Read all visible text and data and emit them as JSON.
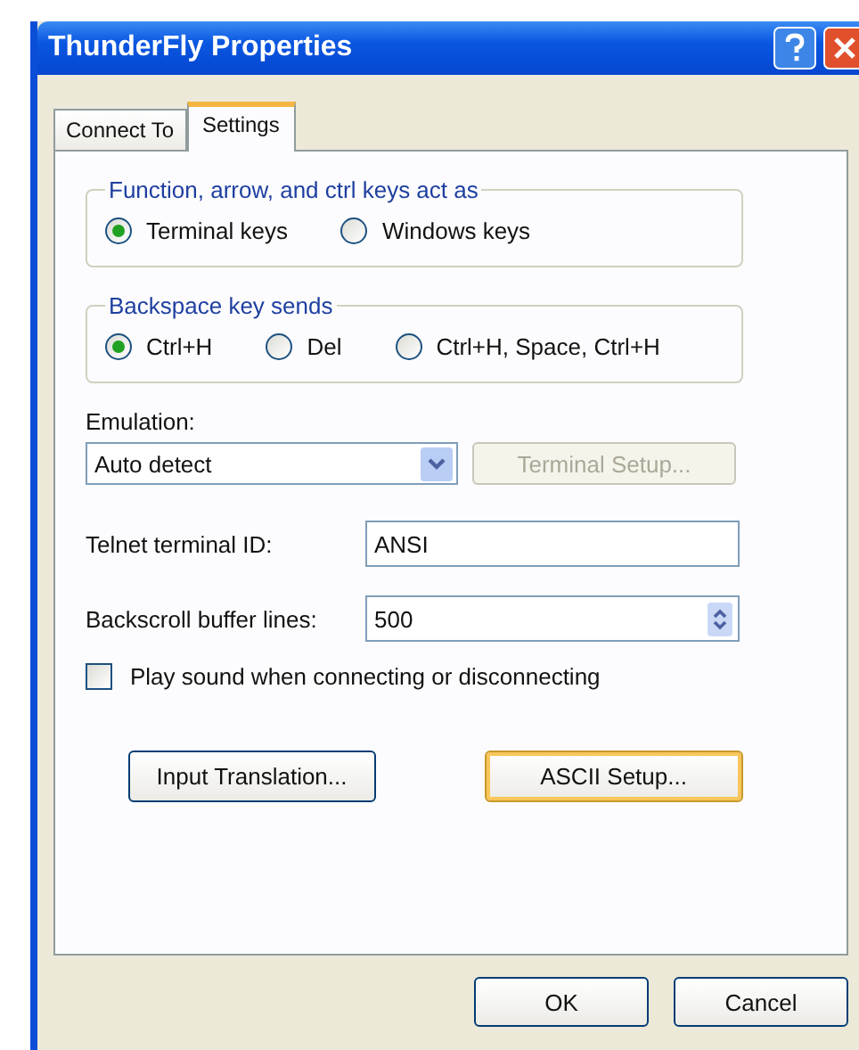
{
  "window": {
    "title": "ThunderFly Properties"
  },
  "tabs": [
    {
      "label": "Connect To",
      "selected": false
    },
    {
      "label": "Settings",
      "selected": true
    }
  ],
  "groups": [
    {
      "title": "Function, arrow, and ctrl keys act as",
      "options": [
        {
          "label": "Terminal keys",
          "selected": true
        },
        {
          "label": "Windows keys",
          "selected": false
        }
      ]
    },
    {
      "title": "Backspace key sends",
      "options": [
        {
          "label": "Ctrl+H",
          "selected": true
        },
        {
          "label": "Del",
          "selected": false
        },
        {
          "label": "Ctrl+H, Space, Ctrl+H",
          "selected": false
        }
      ]
    }
  ],
  "emulation": {
    "label": "Emulation:",
    "value": "Auto detect"
  },
  "terminal_setup": {
    "label": "Terminal Setup...",
    "disabled": true
  },
  "telnet_id": {
    "label": "Telnet terminal ID:",
    "value": "ANSI"
  },
  "backscroll": {
    "label": "Backscroll buffer lines:",
    "value": "500"
  },
  "play_sound": {
    "label": "Play sound when connecting or disconnecting",
    "checked": false
  },
  "buttons": [
    {
      "label": "Input Translation...",
      "focused": false
    },
    {
      "label": "ASCII Setup...",
      "focused": true
    }
  ],
  "dialog_buttons": [
    {
      "label": "OK"
    },
    {
      "label": "Cancel"
    }
  ]
}
